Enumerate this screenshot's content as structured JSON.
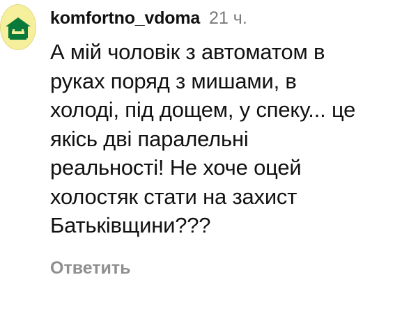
{
  "comment": {
    "avatar_icon": "house-logo-icon",
    "username": "komfortno_vdoma",
    "timestamp": "21 ч.",
    "text_lines": [
      "А мій чоловік з автоматом в",
      "руках поряд з мишами, в",
      "холоді, під дощем, у спеку... це",
      "якісь дві паралельні",
      "реальності! Не хоче оцей",
      "холостяк стати на захист",
      "Батьківщини???"
    ],
    "reply_label": "Ответить"
  },
  "colors": {
    "avatar_bg": "#f6ef9c",
    "logo_green": "#0a7a3b",
    "muted_text": "#8f8f8f"
  }
}
